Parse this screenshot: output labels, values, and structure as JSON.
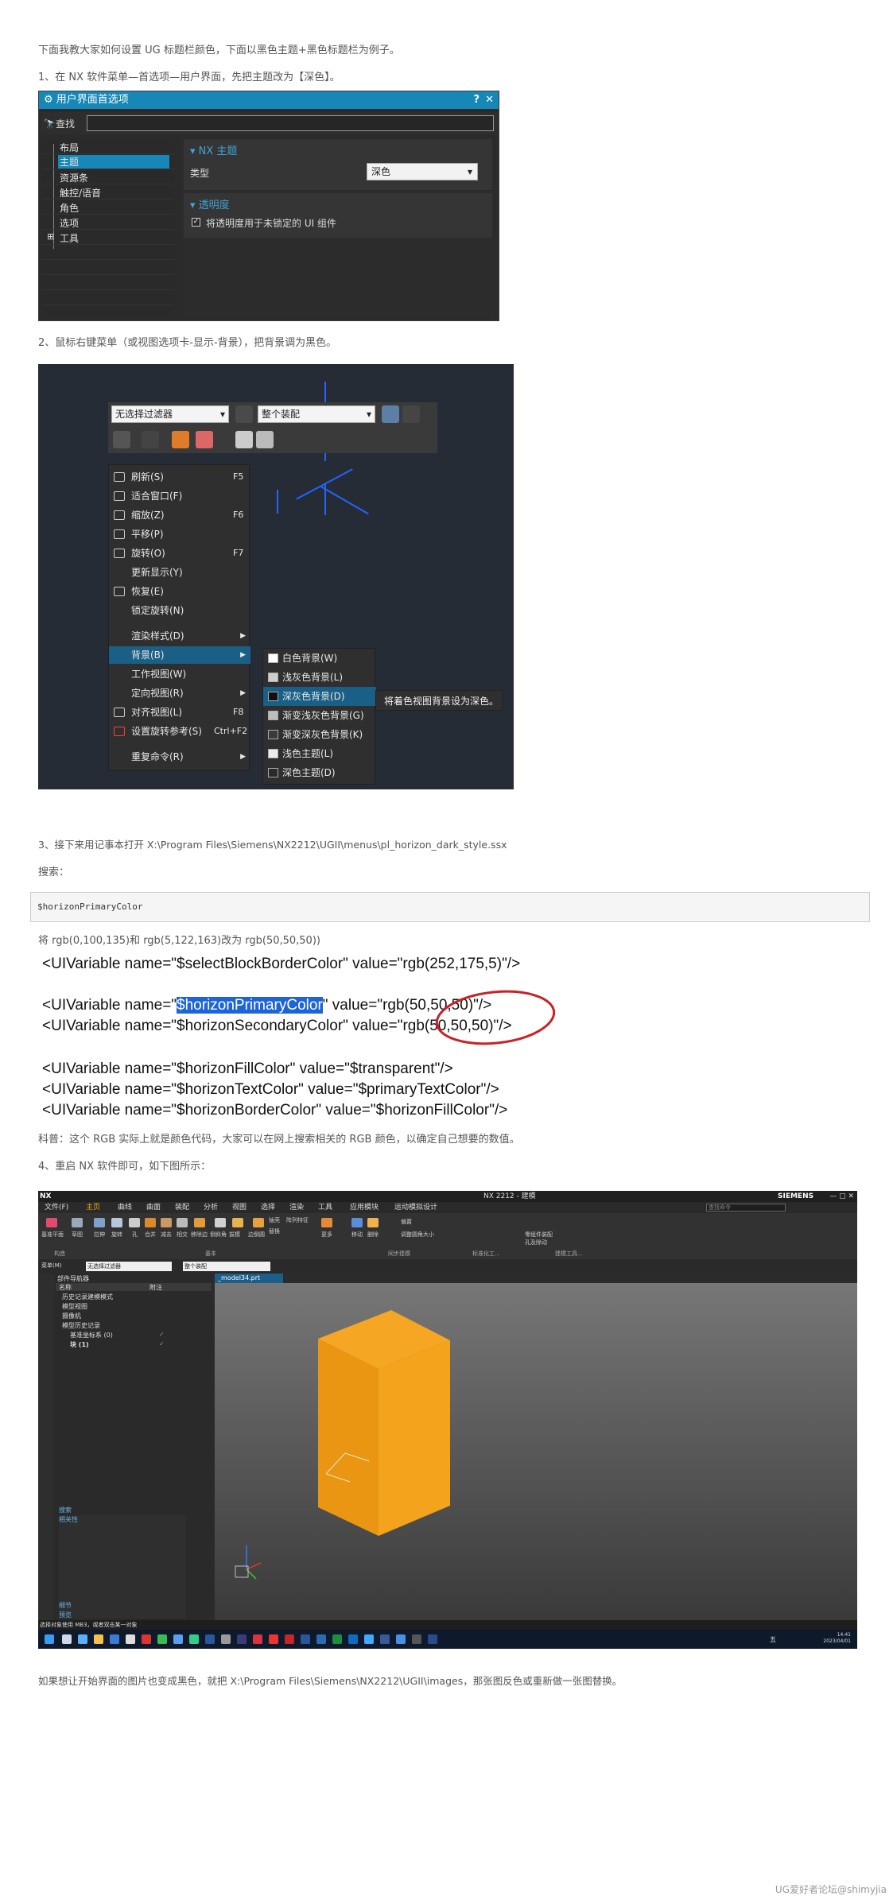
{
  "texts": {
    "intro": "下面我教大家如何设置 UG 标题栏颜色，下面以黑色主题+黑色标题栏为例子。",
    "step1": "1、在 NX 软件菜单—首选项—用户界面，先把主题改为【深色】。",
    "step2": "2、鼠标右键菜单（或视图选项卡-显示-背景），把背景调为黑色。",
    "step3": "3、接下来用记事本打开 X:\\Program Files\\Siemens\\NX2212\\UGII\\menus\\pl_horizon_dark_style.ssx",
    "search_label": "搜索：",
    "code": "$horizonPrimaryColor",
    "change_note": "将 rgb(0,100,135)和 rgb(5,122,163)改为 rgb(50,50,50))",
    "science": "科普：这个 RGB 实际上就是颜色代码，大家可以在网上搜索相关的 RGB 颜色，以确定自己想要的数值。",
    "step4": "4、重启 NX 软件即可，如下图所示：",
    "outro": "如果想让开始界面的图片也变成黑色，就把 X:\\Program Files\\Siemens\\NX2212\\UGII\\images，那张图反色或重新做一张图替换。",
    "watermark": "UG爱好者论坛@shimyjia"
  },
  "dialog": {
    "title": "用户界面首选项",
    "help": "?",
    "close": "✕",
    "search_label": "查找",
    "tree": [
      "布局",
      "主题",
      "资源条",
      "触控/语音",
      "角色",
      "选项",
      "工具"
    ],
    "selected_index": 1,
    "section1": "NX 主题",
    "type_label": "类型",
    "type_value": "深色",
    "section2": "透明度",
    "checkbox_label": "将透明度用于未锁定的 UI 组件",
    "checkbox_checked": true
  },
  "context": {
    "filter": "无选择过滤器",
    "assembly": "整个装配",
    "menu": [
      {
        "label": "刷新(S)",
        "key": "F5",
        "icon": "refresh-icon"
      },
      {
        "label": "适合窗口(F)",
        "key": "",
        "icon": "fit-icon"
      },
      {
        "label": "缩放(Z)",
        "key": "F6",
        "icon": "zoom-icon"
      },
      {
        "label": "平移(P)",
        "key": "",
        "icon": "pan-icon"
      },
      {
        "label": "旋转(O)",
        "key": "F7",
        "icon": "rotate-icon"
      },
      {
        "label": "更新显示(Y)",
        "key": "",
        "icon": ""
      },
      {
        "label": "恢复(E)",
        "key": "",
        "icon": "restore-icon"
      },
      {
        "label": "锁定旋转(N)",
        "key": "",
        "icon": ""
      },
      {
        "label": "渲染样式(D)",
        "key": "",
        "icon": "",
        "arrow": true
      },
      {
        "label": "背景(B)",
        "key": "",
        "icon": "",
        "arrow": true,
        "hl": true
      },
      {
        "label": "工作视图(W)",
        "key": "",
        "icon": ""
      },
      {
        "label": "定向视图(R)",
        "key": "",
        "icon": "",
        "arrow": true
      },
      {
        "label": "对齐视图(L)",
        "key": "F8",
        "icon": "align-icon"
      },
      {
        "label": "设置旋转参考(S)",
        "key": "Ctrl+F2",
        "icon": "rotate-ref-icon"
      },
      {
        "label": "重复命令(R)",
        "key": "",
        "icon": "",
        "arrow": true
      }
    ],
    "submenu": [
      {
        "label": "白色背景(W)",
        "color": "#ffffff"
      },
      {
        "label": "浅灰色背景(L)",
        "color": "#cfcfcf"
      },
      {
        "label": "深灰色背景(D)",
        "color": "#111111",
        "hl": true
      },
      {
        "label": "渐变浅灰色背景(G)",
        "color": "#bdbdbd"
      },
      {
        "label": "渐变深灰色背景(K)",
        "color": "#3a3a3a"
      },
      {
        "label": "浅色主题(L)",
        "color": "#eeeeee"
      },
      {
        "label": "深色主题(D)",
        "color": "#2a2a2a"
      }
    ],
    "tooltip": "将着色视图背景设为深色。"
  },
  "xml": {
    "l1a": "<UIVariable name=\"",
    "l1b": "$selectBlockBorderColor\" value=\"rgb(252,175,5)\"/>",
    "l2a": "<UIVariable name=\"",
    "l2hl": "$horizonPrimaryColor",
    "l2b": "\" value=\"rgb(50,50,50)\"/>",
    "l3": "<UIVariable name=\"$horizonSecondaryColor\" value=\"rgb(50,50,50)\"/>",
    "l4": "<UIVariable name=\"$horizonFillColor\" value=\"$transparent\"/>",
    "l5": "<UIVariable name=\"$horizonTextColor\" value=\"$primaryTextColor\"/>",
    "l6": "<UIVariable name=\"$horizonBorderColor\" value=\"$horizonFillColor\"/>"
  },
  "nx": {
    "logo": "NX",
    "title": "NX 2212 - 建模",
    "brand": "SIEMENS",
    "search_placeholder": "查找命令",
    "menus": [
      "文件(F)",
      "主页",
      "曲线",
      "曲面",
      "装配",
      "分析",
      "视图",
      "选择",
      "渲染",
      "工具",
      "应用模块",
      "运动模拟设计"
    ],
    "ribbon": [
      "基准平面",
      "草图",
      "拉伸",
      "旋转",
      "孔",
      "合并",
      "减去",
      "相交",
      "移除边",
      "倒斜角",
      "拔模",
      "边倒圆",
      "抽壳",
      "阵列特征",
      "替换",
      "移动",
      "删除",
      "偏置",
      "调整圆角大小",
      "更多",
      "零组件装配",
      "孔及除动"
    ],
    "groups": [
      "构造",
      "基本",
      "同步建模",
      "标准化工...",
      "建模工具..."
    ],
    "filter1": "菜单(M)",
    "filter2": "无选择过滤器",
    "filter3": "整个装配",
    "nav_title": "部件导航器",
    "nav_cols": [
      "名称",
      "附注"
    ],
    "nav_items": [
      "历史记录建模模式",
      "模型视图",
      "摄像机",
      "模型历史记录",
      "基准坐标系 (0)",
      "块 (1)"
    ],
    "tab": "_model34.prt",
    "panel_search": "搜索",
    "panel_rel": "相关性",
    "panel_detail": "细节",
    "panel_preview": "预览",
    "status": "选择对象使用 MB3，或者双击某一对象",
    "clock": "14:41",
    "date": "2023/04/01",
    "lang": "五"
  }
}
